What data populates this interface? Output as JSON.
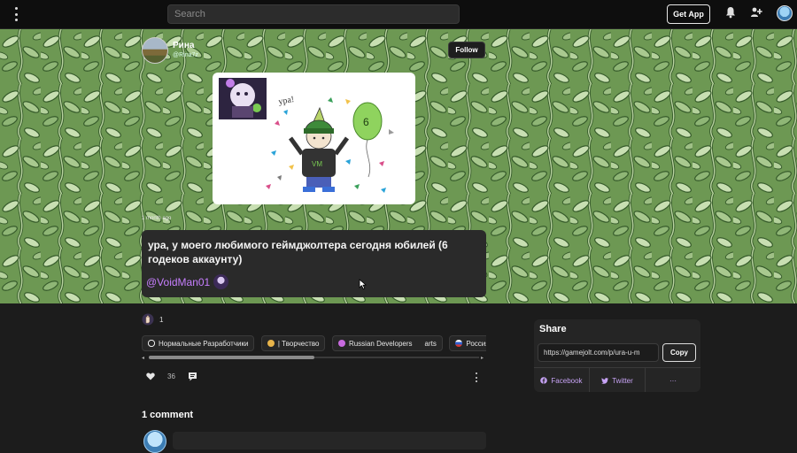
{
  "topbar": {
    "search_placeholder": "Search",
    "get_app_label": "Get App"
  },
  "author": {
    "name": "Рина",
    "handle": "@Rina7z",
    "follow_label": "Follow"
  },
  "post": {
    "time": "1 month ago",
    "text": "ура, у моего любимого геймджолтера сегодня юбилей (6 годеков аккаунту)",
    "mention": "@VoidMan01",
    "image_caption": "ура!",
    "balloon_number": "6"
  },
  "reaction": {
    "count": "1"
  },
  "communities": [
    {
      "label": "Нормальные Разработчики",
      "color": "#f0f0f0"
    },
    {
      "label": "| Творчество",
      "color": "#e8b44a"
    },
    {
      "label": "Russian Developers",
      "color": "#c86adf"
    },
    {
      "label": "arts",
      "color": ""
    },
    {
      "label": "Россия в Gamejolt",
      "color": "#2f5fcf"
    }
  ],
  "likes": {
    "count": "36"
  },
  "comments": {
    "title": "1 comment"
  },
  "share": {
    "title": "Share",
    "url": "https://gamejolt.com/p/ura-u-m",
    "copy_label": "Copy",
    "facebook_label": "Facebook",
    "twitter_label": "Twitter",
    "more_label": "···"
  }
}
